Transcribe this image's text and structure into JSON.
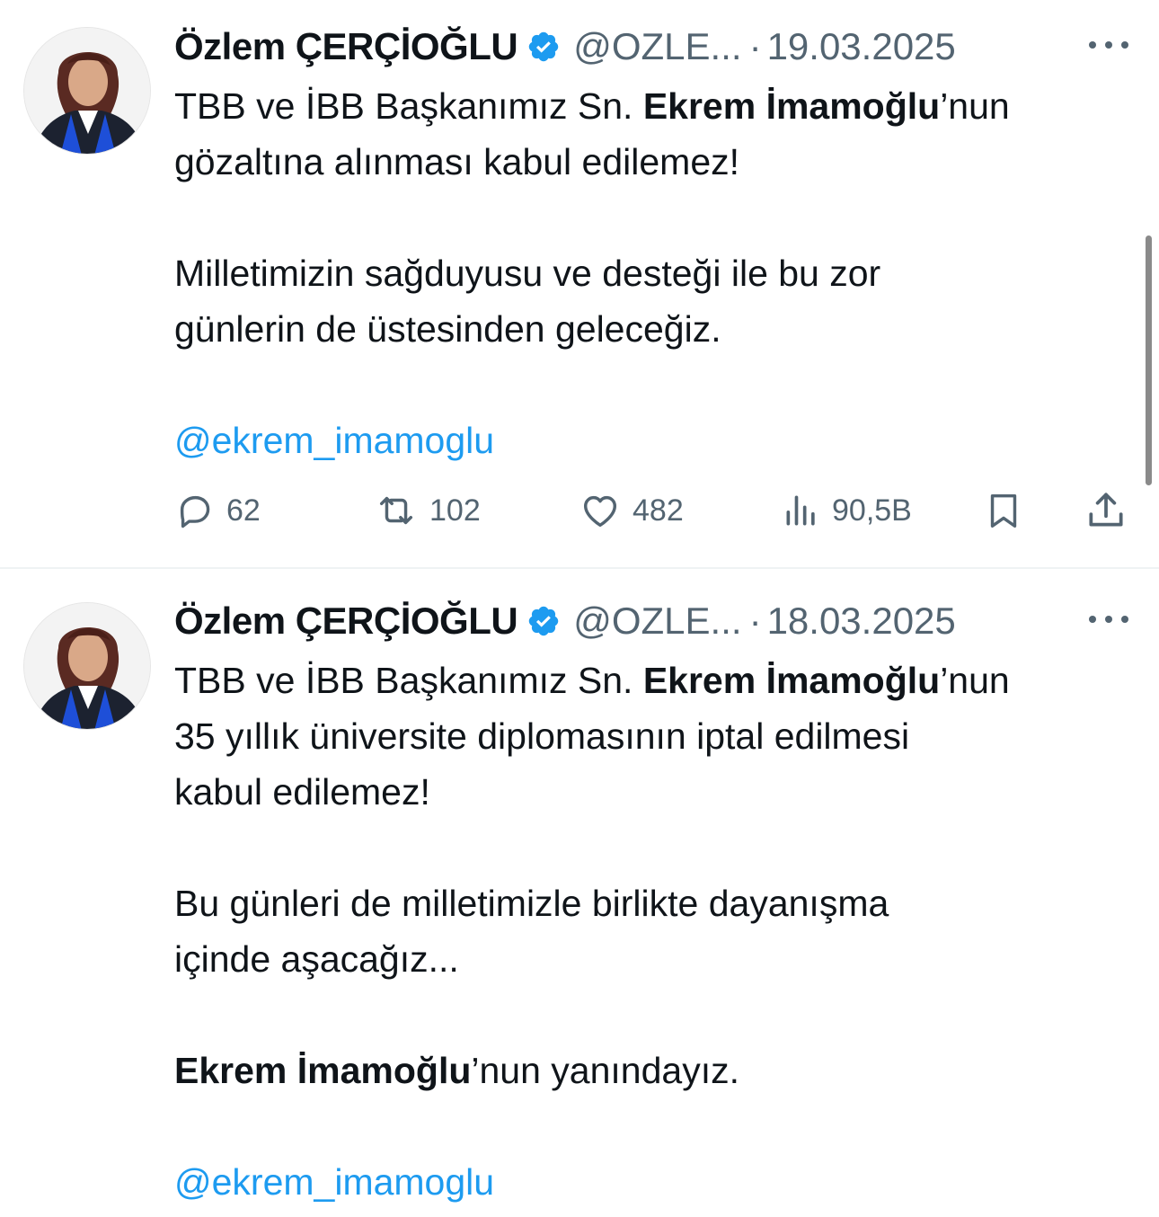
{
  "tweets": [
    {
      "author_name": "Özlem ÇERÇİOĞLU",
      "handle": "@OZLE...",
      "separator": "·",
      "date": "19.03.2025",
      "text": {
        "l1a": "TBB ve İBB Başkanımız Sn. ",
        "l1b": "Ekrem İmamoğlu",
        "l1c": "’nun",
        "l2": "gözaltına alınması kabul edilemez!",
        "l3": "Milletimizin sağduyusu ve desteği ile bu zor",
        "l4": "günlerin de üstesinden geleceğiz.",
        "mention": "@ekrem_imamoglu"
      },
      "stats": {
        "replies": "62",
        "retweets": "102",
        "likes": "482",
        "views": "90,5B"
      }
    },
    {
      "author_name": "Özlem ÇERÇİOĞLU",
      "handle": "@OZLE...",
      "separator": "·",
      "date": "18.03.2025",
      "text": {
        "l1a": "TBB ve İBB Başkanımız Sn. ",
        "l1b": "Ekrem İmamoğlu",
        "l1c": "’nun",
        "l2": "35 yıllık üniversite diplomasının iptal edilmesi",
        "l3": "kabul edilemez!",
        "l4": "Bu günleri de milletimizle birlikte dayanışma",
        "l5": "içinde aşacağız...",
        "l6a": "Ekrem İmamoğlu",
        "l6b": "’nun yanındayız.",
        "mention": "@ekrem_imamoglu"
      }
    }
  ],
  "colors": {
    "text": "#0f1419",
    "secondary": "#536471",
    "link": "#1d9bf0",
    "divider": "#eff3f4",
    "verified": "#1d9bf0"
  },
  "icons": [
    "verified-badge-icon",
    "more-options-icon",
    "reply-icon",
    "retweet-icon",
    "like-icon",
    "views-icon",
    "bookmark-icon",
    "share-icon"
  ]
}
